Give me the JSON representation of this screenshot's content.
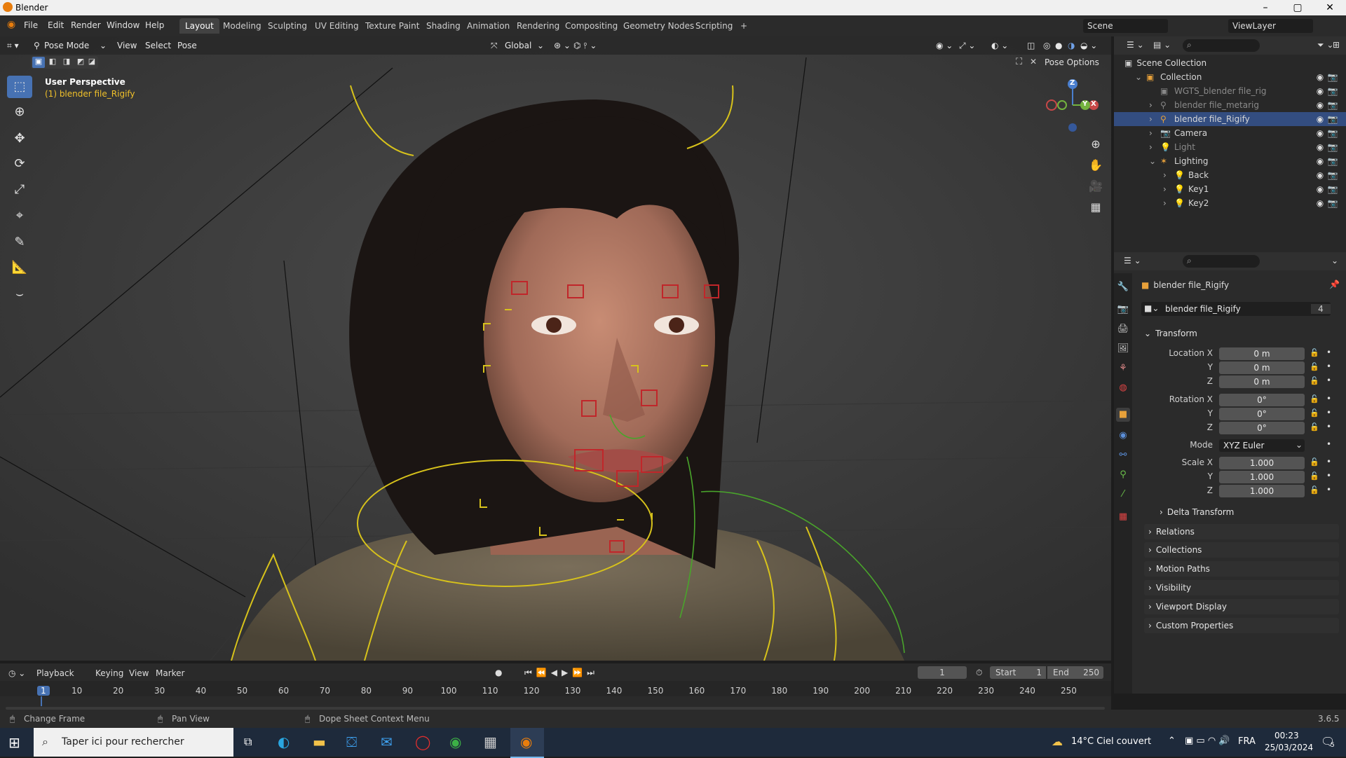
{
  "window": {
    "title": "Blender",
    "minimize": "–",
    "maximize": "▢",
    "close": "✕"
  },
  "topmenu": [
    "File",
    "Edit",
    "Render",
    "Window",
    "Help"
  ],
  "workspaces": [
    "Layout",
    "Modeling",
    "Sculpting",
    "UV Editing",
    "Texture Paint",
    "Shading",
    "Animation",
    "Rendering",
    "Compositing",
    "Geometry Nodes",
    "Scripting",
    "+"
  ],
  "scene": {
    "name": "Scene",
    "view_layer": "ViewLayer"
  },
  "viewport": {
    "mode": "Pose Mode",
    "menus": [
      "View",
      "Select",
      "Pose"
    ],
    "transform_orientation": "Global",
    "pose_options": "Pose Options",
    "perspective": "User Perspective",
    "object": "(1) blender file_Rigify",
    "axis_x": "X",
    "axis_y": "Y",
    "axis_z": "Z"
  },
  "tools": [
    {
      "name": "select-box-tool",
      "icon": "⬚",
      "active": true
    },
    {
      "name": "cursor-tool",
      "icon": "⊕"
    },
    {
      "name": "move-tool",
      "icon": "✥"
    },
    {
      "name": "rotate-tool",
      "icon": "⟳"
    },
    {
      "name": "scale-tool",
      "icon": "⤢"
    },
    {
      "name": "transform-tool",
      "icon": "⌖"
    },
    {
      "name": "annotate-tool",
      "icon": "✎"
    },
    {
      "name": "measure-tool",
      "icon": "📐"
    },
    {
      "name": "bone-size-tool",
      "icon": "⌣"
    }
  ],
  "outliner": {
    "root": "Scene Collection",
    "rows": [
      {
        "label": "Collection",
        "indent": 0,
        "icon": "▣",
        "expander": "⌄",
        "vis": true
      },
      {
        "label": "WGTS_blender file_rig",
        "indent": 1,
        "icon": "▣",
        "expander": "",
        "vis": true,
        "dim": true
      },
      {
        "label": "blender file_metarig",
        "indent": 1,
        "icon": "⚲",
        "expander": "›",
        "vis": true,
        "dim": true
      },
      {
        "label": "blender file_Rigify",
        "indent": 1,
        "icon": "⚲",
        "expander": "›",
        "vis": true,
        "selected": true
      },
      {
        "label": "Camera",
        "indent": 1,
        "icon": "📷",
        "expander": "›",
        "vis": true
      },
      {
        "label": "Light",
        "indent": 1,
        "icon": "💡",
        "expander": "›",
        "vis": true,
        "dim": true
      },
      {
        "label": "Lighting",
        "indent": 1,
        "icon": "✶",
        "expander": "⌄",
        "vis": true
      },
      {
        "label": "Back",
        "indent": 2,
        "icon": "💡",
        "expander": "›",
        "vis": true
      },
      {
        "label": "Key1",
        "indent": 2,
        "icon": "💡",
        "expander": "›",
        "vis": true
      },
      {
        "label": "Key2",
        "indent": 2,
        "icon": "💡",
        "expander": "›",
        "vis": true
      }
    ]
  },
  "properties": {
    "object_name": "blender file_Rigify",
    "data_name": "blender file_Rigify",
    "users": "4",
    "transform_label": "Transform",
    "location": {
      "label": "Location X",
      "x": "0 m",
      "y": "0 m",
      "z": "0 m"
    },
    "rotation": {
      "label": "Rotation X",
      "x": "0°",
      "y": "0°",
      "z": "0°"
    },
    "mode_label": "Mode",
    "mode_value": "XYZ Euler",
    "scale": {
      "label": "Scale X",
      "x": "1.000",
      "y": "1.000",
      "z": "1.000"
    },
    "axis_y": "Y",
    "axis_z": "Z",
    "panels": [
      "Delta Transform",
      "Relations",
      "Collections",
      "Motion Paths",
      "Visibility",
      "Viewport Display",
      "Custom Properties"
    ]
  },
  "timeline": {
    "menus": [
      "Playback",
      "Keying",
      "View",
      "Marker"
    ],
    "current_frame": "1",
    "start_label": "Start",
    "start": "1",
    "end_label": "End",
    "end": "250",
    "ticks": [
      "1",
      "10",
      "20",
      "30",
      "40",
      "50",
      "60",
      "70",
      "80",
      "90",
      "100",
      "110",
      "120",
      "130",
      "140",
      "150",
      "160",
      "170",
      "180",
      "190",
      "200",
      "210",
      "220",
      "230",
      "240",
      "250"
    ]
  },
  "status": {
    "left": "Change Frame",
    "mid": "Pan View",
    "right": "Dope Sheet Context Menu",
    "version": "3.6.5"
  },
  "taskbar": {
    "search": "Taper ici pour rechercher",
    "weather": "14°C  Ciel couvert",
    "lang": "FRA",
    "time": "00:23",
    "date": "25/03/2024",
    "notif": "5"
  },
  "colors": {
    "accent": "#4772b3",
    "selected_row": "#334d80",
    "bone_yellow": "#d7c21b",
    "bone_red": "#c0262a",
    "bone_green": "#49a42b"
  }
}
